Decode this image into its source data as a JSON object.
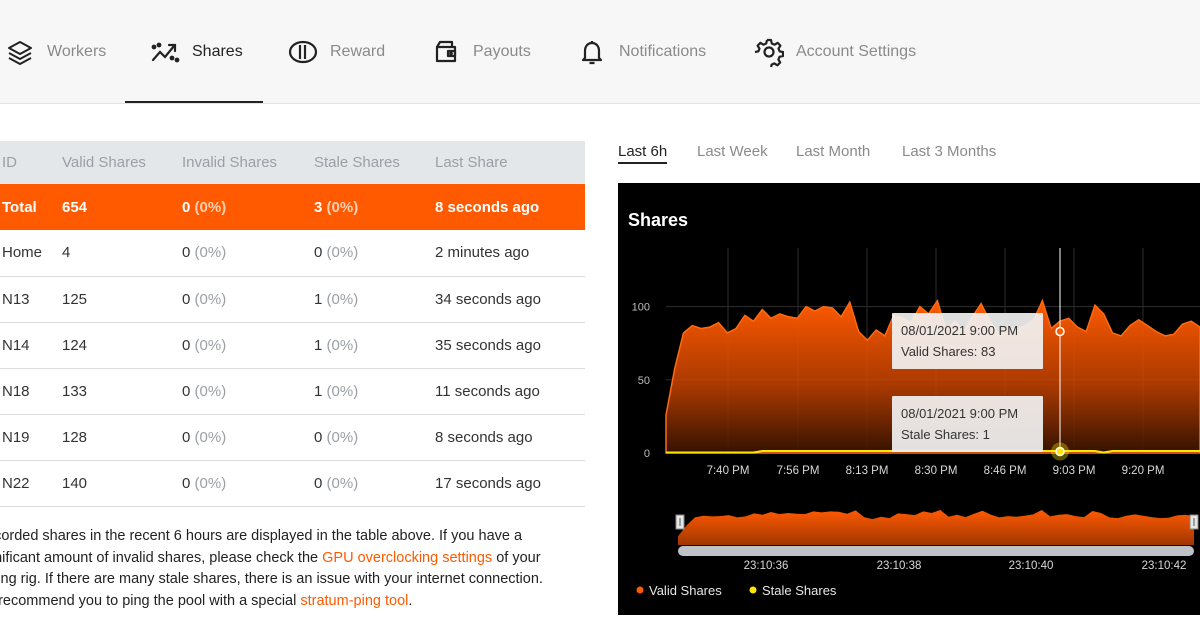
{
  "nav": {
    "items": [
      {
        "label": "Workers",
        "icon": "layers-icon"
      },
      {
        "label": "Shares",
        "icon": "trend-icon"
      },
      {
        "label": "Reward",
        "icon": "coin-icon"
      },
      {
        "label": "Payouts",
        "icon": "wallet-icon"
      },
      {
        "label": "Notifications",
        "icon": "bell-icon"
      },
      {
        "label": "Account Settings",
        "icon": "gear-icon"
      }
    ],
    "active": "Shares"
  },
  "table": {
    "headers": [
      "ID",
      "Valid Shares",
      "Invalid Shares",
      "Stale Shares",
      "Last Share"
    ],
    "total": {
      "id": "Total",
      "valid": "654",
      "invalid": "0",
      "invalid_pct": "(0%)",
      "stale": "3",
      "stale_pct": "(0%)",
      "last": "8 seconds ago"
    },
    "rows": [
      {
        "id": "Home",
        "valid": "4",
        "invalid": "0",
        "invalid_pct": "(0%)",
        "stale": "0",
        "stale_pct": "(0%)",
        "last": "2 minutes ago"
      },
      {
        "id": "N13",
        "valid": "125",
        "invalid": "0",
        "invalid_pct": "(0%)",
        "stale": "1",
        "stale_pct": "(0%)",
        "last": "34 seconds ago"
      },
      {
        "id": "N14",
        "valid": "124",
        "invalid": "0",
        "invalid_pct": "(0%)",
        "stale": "1",
        "stale_pct": "(0%)",
        "last": "35 seconds ago"
      },
      {
        "id": "N18",
        "valid": "133",
        "invalid": "0",
        "invalid_pct": "(0%)",
        "stale": "1",
        "stale_pct": "(0%)",
        "last": "11 seconds ago"
      },
      {
        "id": "N19",
        "valid": "128",
        "invalid": "0",
        "invalid_pct": "(0%)",
        "stale": "0",
        "stale_pct": "(0%)",
        "last": "8 seconds ago"
      },
      {
        "id": "N22",
        "valid": "140",
        "invalid": "0",
        "invalid_pct": "(0%)",
        "stale": "0",
        "stale_pct": "(0%)",
        "last": "17 seconds ago"
      }
    ]
  },
  "note": {
    "line1": "ecorded shares in the recent 6 hours are displayed in the table above. If you have a",
    "line2_pre": "gnificant amount of invalid shares, please check the ",
    "line2_link": "GPU overclocking settings",
    "line2_post": " of your",
    "line3": "ining rig. If there are many stale shares, there is an issue with your internet connection.",
    "line4_pre": "e recommend you to ping the pool with a special ",
    "line4_link": "stratum-ping tool",
    "line4_post": "."
  },
  "range_tabs": [
    "Last 6h",
    "Last Week",
    "Last Month",
    "Last 3 Months"
  ],
  "range_active": "Last 6h",
  "chart_data": {
    "type": "area",
    "title": "Shares",
    "x_ticks": [
      "7:40 PM",
      "7:56 PM",
      "8:13 PM",
      "8:30 PM",
      "8:46 PM",
      "9:03 PM",
      "9:20 PM"
    ],
    "y_ticks": [
      0,
      50,
      100
    ],
    "ylim": [
      0,
      140
    ],
    "series": [
      {
        "name": "Valid Shares",
        "color": "#ff5a00",
        "values": [
          26,
          58,
          82,
          87,
          85,
          86,
          89,
          82,
          85,
          94,
          90,
          98,
          92,
          95,
          93,
          92,
          100,
          97,
          100,
          99,
          93,
          103,
          83,
          77,
          84,
          80,
          94,
          92,
          89,
          100,
          95,
          104,
          84,
          90,
          83,
          93,
          102,
          90,
          82,
          86,
          84,
          87,
          91,
          104,
          85,
          90,
          92,
          86,
          83,
          101,
          95,
          82,
          80,
          87,
          91,
          87,
          83,
          80,
          81,
          88,
          90,
          86
        ]
      },
      {
        "name": "Stale Shares",
        "color": "#ffe600",
        "values": [
          0,
          0,
          0,
          0,
          0,
          0,
          0,
          0,
          0,
          0,
          0,
          1,
          1,
          1,
          1,
          1,
          1,
          1,
          1,
          1,
          1,
          1,
          1,
          1,
          1,
          1,
          1,
          1,
          1,
          1,
          1,
          1,
          1,
          1,
          1,
          1,
          1,
          1,
          1,
          1,
          1,
          1,
          1,
          1,
          1,
          1,
          1,
          1,
          1,
          1,
          0,
          1,
          1,
          1,
          1,
          1,
          1,
          1,
          1,
          1,
          1,
          1
        ]
      }
    ],
    "tooltips": [
      {
        "date": "08/01/2021 9:00 PM",
        "label": "Valid Shares: 83"
      },
      {
        "date": "08/01/2021 9:00 PM",
        "label": "Stale Shares: 1"
      }
    ],
    "navigator_ticks": [
      "23:10:36",
      "23:10:38",
      "23:10:40",
      "23:10:42"
    ],
    "legend": [
      "Valid Shares",
      "Stale Shares"
    ],
    "legend_position": "bottom-left"
  }
}
